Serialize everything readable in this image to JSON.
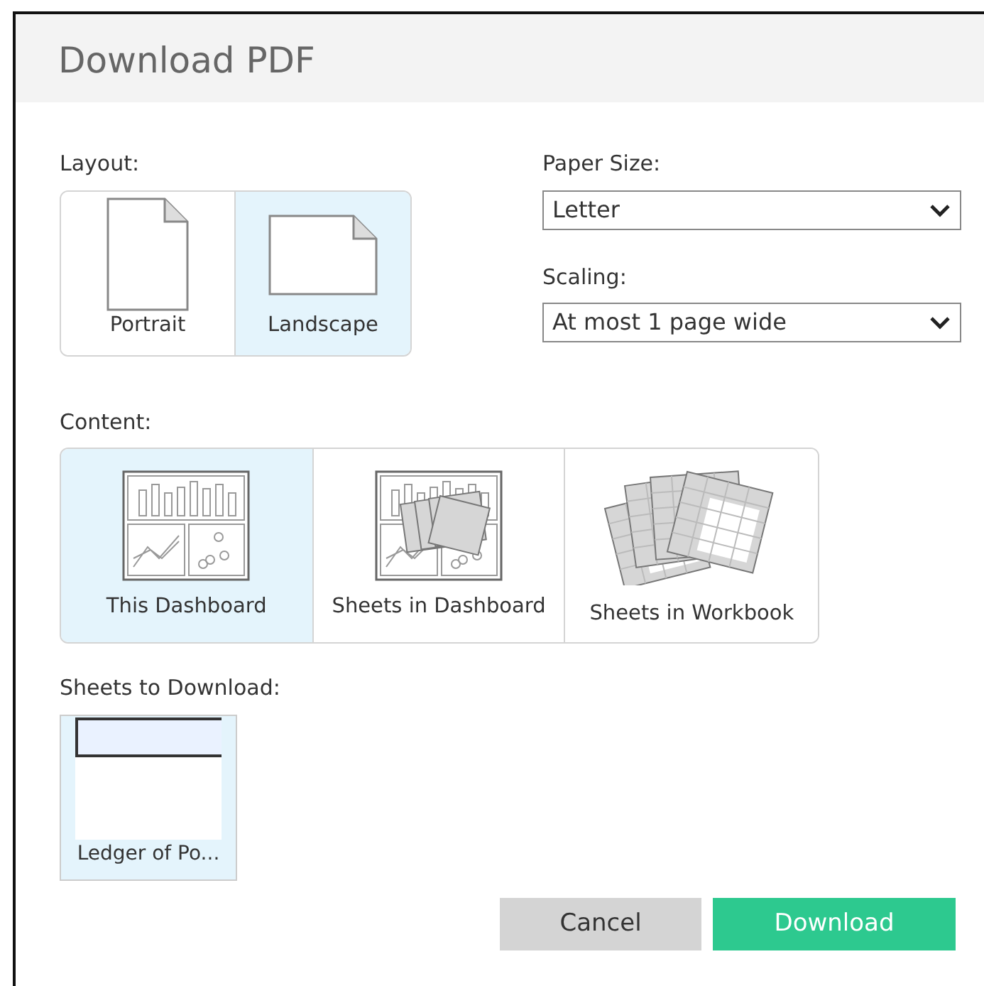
{
  "dialog": {
    "title": "Download PDF"
  },
  "layout": {
    "label": "Layout:",
    "options": [
      {
        "kind": "portrait",
        "label": "Portrait",
        "selected": false
      },
      {
        "kind": "landscape",
        "label": "Landscape",
        "selected": true
      }
    ]
  },
  "paper_size": {
    "label": "Paper Size:",
    "value": "Letter"
  },
  "scaling": {
    "label": "Scaling:",
    "value": "At most 1 page wide"
  },
  "content": {
    "label": "Content:",
    "options": [
      {
        "kind": "dashboard",
        "label": "This Dashboard",
        "selected": true
      },
      {
        "kind": "sheets-dashboard",
        "label": "Sheets in Dashboard",
        "selected": false
      },
      {
        "kind": "workbook",
        "label": "Sheets in Workbook",
        "selected": false
      }
    ]
  },
  "sheets": {
    "label": "Sheets to Download:",
    "items": [
      {
        "label": "Ledger of Po...",
        "selected": true
      }
    ]
  },
  "buttons": [
    {
      "kind": "secondary",
      "label": "Cancel"
    },
    {
      "kind": "primary",
      "label": "Download"
    }
  ]
}
